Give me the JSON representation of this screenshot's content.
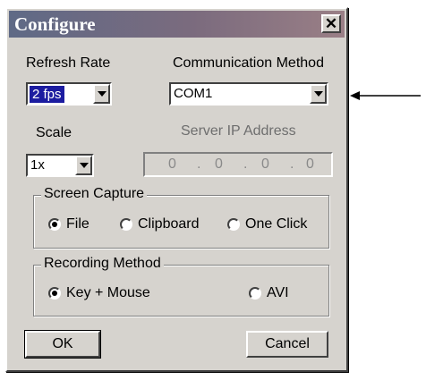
{
  "window": {
    "title": "Configure"
  },
  "refresh_rate": {
    "label": "Refresh Rate",
    "value": "2 fps"
  },
  "communication_method": {
    "label": "Communication Method",
    "value": "COM1"
  },
  "scale": {
    "label": "Scale",
    "value": "1x"
  },
  "server_ip": {
    "label": "Server IP Address",
    "octets": [
      "0",
      "0",
      "0",
      "0"
    ]
  },
  "screen_capture": {
    "legend": "Screen Capture",
    "options": [
      {
        "label": "File",
        "selected": true
      },
      {
        "label": "Clipboard",
        "selected": false
      },
      {
        "label": "One Click",
        "selected": false
      }
    ]
  },
  "recording_method": {
    "legend": "Recording Method",
    "options": [
      {
        "label": "Key + Mouse",
        "selected": true
      },
      {
        "label": "AVI",
        "selected": false
      }
    ]
  },
  "buttons": {
    "ok": "OK",
    "cancel": "Cancel"
  },
  "icons": {
    "close": "close-icon",
    "dropdown": "chevron-down-icon",
    "callout": "arrow-left-icon"
  },
  "colors": {
    "title_gradient_start": "#5f6a86",
    "title_gradient_end": "#9a7f86",
    "selection": "#1c1ca0",
    "face": "#d6d3ce"
  }
}
